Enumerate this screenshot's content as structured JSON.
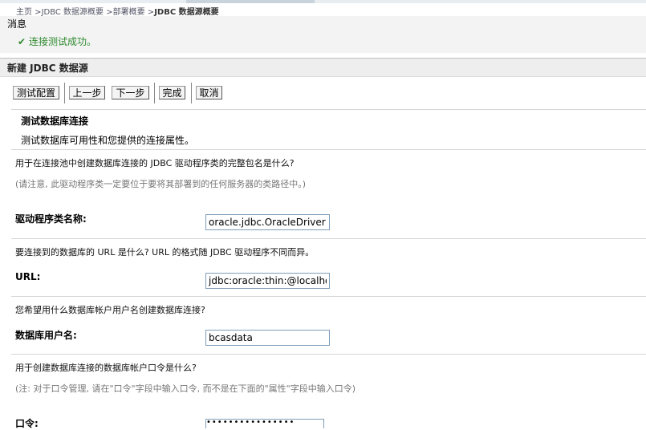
{
  "breadcrumb": {
    "home": "主页",
    "sep1": " >",
    "item1": "JDBC 数据源概要",
    "sep2": " >",
    "item2": "部署概要",
    "sep3": " >",
    "current": "JDBC 数据源概要"
  },
  "messages": {
    "title": "消息",
    "success": "连接测试成功。"
  },
  "panel": {
    "title": "新建 JDBC 数据源"
  },
  "toolbar": {
    "test_config": "测试配置",
    "back": "上一步",
    "next": "下一步",
    "finish": "完成",
    "cancel": "取消"
  },
  "section": {
    "heading": "测试数据库连接",
    "description": "测试数据库可用性和您提供的连接属性。"
  },
  "fields": {
    "driver_question": "用于在连接池中创建数据库连接的 JDBC 驱动程序类的完整包名是什么?",
    "driver_note": "(请注意, 此驱动程序类一定要位于要将其部署到的任何服务器的类路径中。)",
    "driver_label": "驱动程序类名称:",
    "driver_value": "oracle.jdbc.OracleDriver",
    "url_question": "要连接到的数据库的 URL 是什么? URL 的格式随 JDBC 驱动程序不同而异。",
    "url_label": "URL:",
    "url_value": "jdbc:oracle:thin:@localhost",
    "user_question": "您希望用什么数据库帐户用户名创建数据库连接?",
    "user_label": "数据库用户名:",
    "user_value": "bcasdata",
    "password_question": "用于创建数据库连接的数据库帐户口令是什么?",
    "password_note": "(注: 对于口令管理, 请在\"口令\"字段中输入口令, 而不是在下面的\"属性\"字段中输入口令)",
    "password_label": "口令:",
    "password_mask": "••••••••••••••••"
  },
  "colors": {
    "success_green": "#2f8a2f",
    "input_border": "#7f9db9",
    "panel_bg": "#eeeeee"
  },
  "icons": {
    "success": "check-icon"
  }
}
